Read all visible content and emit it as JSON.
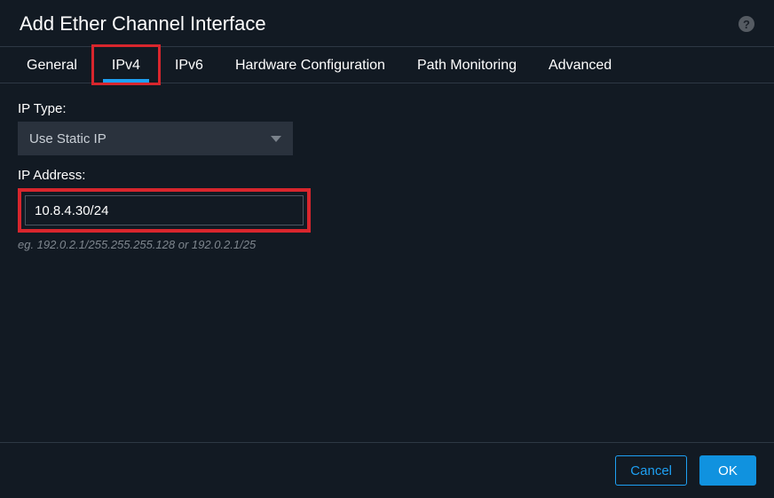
{
  "header": {
    "title": "Add Ether Channel Interface"
  },
  "tabs": {
    "general": "General",
    "ipv4": "IPv4",
    "ipv6": "IPv6",
    "hardware": "Hardware Configuration",
    "path_monitoring": "Path Monitoring",
    "advanced": "Advanced",
    "active": "ipv4"
  },
  "form": {
    "ip_type_label": "IP Type:",
    "ip_type_value": "Use Static IP",
    "ip_address_label": "IP Address:",
    "ip_address_value": "10.8.4.30/24",
    "ip_address_hint": "eg. 192.0.2.1/255.255.255.128 or 192.0.2.1/25"
  },
  "footer": {
    "cancel": "Cancel",
    "ok": "OK"
  }
}
